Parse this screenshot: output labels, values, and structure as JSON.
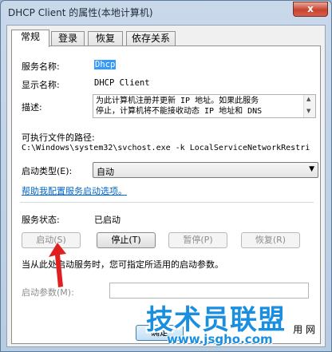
{
  "window": {
    "title": "DHCP Client 的属性(本地计算机)",
    "close_label": "x"
  },
  "tabs": [
    {
      "label": "常规",
      "active": true
    },
    {
      "label": "登录",
      "active": false
    },
    {
      "label": "恢复",
      "active": false
    },
    {
      "label": "依存关系",
      "active": false
    }
  ],
  "general": {
    "service_name_label": "服务名称:",
    "service_name_value": "Dhcp",
    "display_name_label": "显示名称:",
    "display_name_value": "DHCP Client",
    "description_label": "描述:",
    "description_line1": "为此计算机注册并更新 IP 地址。如果此服务",
    "description_line2": "停止，计算机将不能接收动态 IP 地址和 DNS",
    "exe_path_label": "可执行文件的路径:",
    "exe_path_value": "C:\\Windows\\system32\\svchost.exe -k LocalServiceNetworkRestri",
    "startup_type_label": "启动类型(E):",
    "startup_type_value": "自动",
    "help_link": "帮助我配置服务启动选项。",
    "service_status_label": "服务状态:",
    "service_status_value": "已启动",
    "start_button": "启动(S)",
    "stop_button": "停止(T)",
    "pause_button": "暂停(P)",
    "resume_button": "恢复(R)",
    "hint_text": "当从此处启动服务时，您可指定所适用的启动参数。",
    "start_params_label": "启动参数(M):",
    "start_params_value": ""
  },
  "footer": {
    "ok_partial": "确定",
    "apply_partial": "用 网"
  },
  "watermark": {
    "main": "技术员联盟",
    "url": "www.jsgho.com"
  },
  "colors": {
    "accent": "#3399ff",
    "link": "#0066cc",
    "arrow": "#e02020",
    "watermark": "#1a8fe0"
  }
}
